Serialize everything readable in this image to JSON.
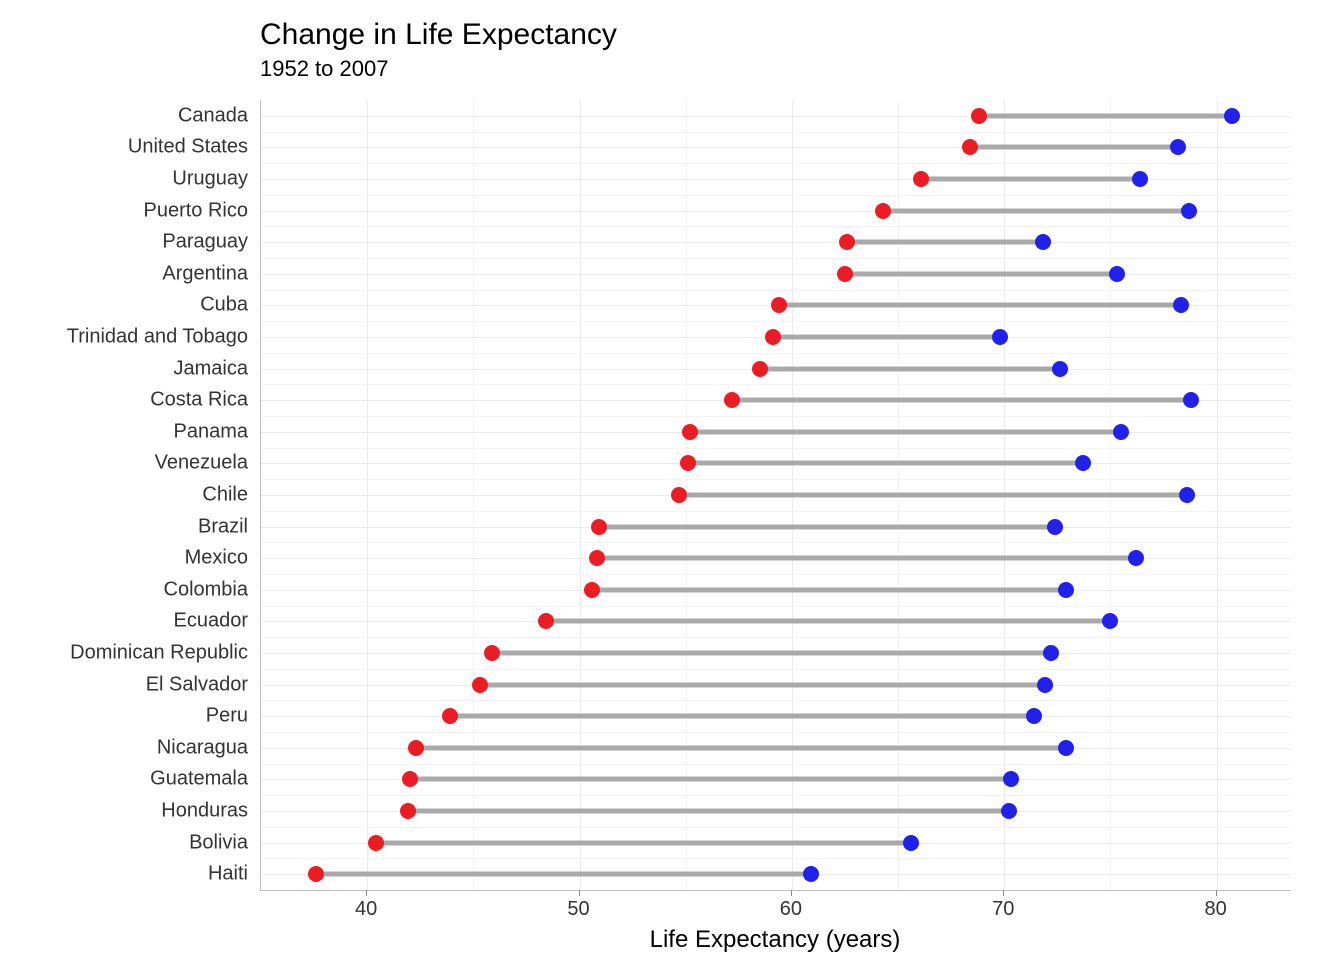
{
  "chart_data": {
    "type": "dumbbell",
    "title": "Change in Life Expectancy",
    "subtitle": "1952 to 2007",
    "xlabel": "Life Expectancy (years)",
    "ylabel": "",
    "xlim": [
      35,
      83.5
    ],
    "x_ticks": [
      40,
      50,
      60,
      70,
      80
    ],
    "colors": {
      "1952": "#ec1c24",
      "2007": "#2121ee",
      "segment": "#a9a9a9"
    },
    "series_names": [
      "1952",
      "2007"
    ],
    "categories": [
      "Canada",
      "United States",
      "Uruguay",
      "Puerto Rico",
      "Paraguay",
      "Argentina",
      "Cuba",
      "Trinidad and Tobago",
      "Jamaica",
      "Costa Rica",
      "Panama",
      "Venezuela",
      "Chile",
      "Brazil",
      "Mexico",
      "Colombia",
      "Ecuador",
      "Dominican Republic",
      "El Salvador",
      "Peru",
      "Nicaragua",
      "Guatemala",
      "Honduras",
      "Bolivia",
      "Haiti"
    ],
    "series": [
      {
        "name": "1952",
        "values": [
          68.8,
          68.4,
          66.1,
          64.3,
          62.6,
          62.5,
          59.4,
          59.1,
          58.5,
          57.2,
          55.2,
          55.1,
          54.7,
          50.9,
          50.8,
          50.6,
          48.4,
          45.9,
          45.3,
          43.9,
          42.3,
          42.0,
          41.9,
          40.4,
          37.6
        ]
      },
      {
        "name": "2007",
        "values": [
          80.7,
          78.2,
          76.4,
          78.7,
          71.8,
          75.3,
          78.3,
          69.8,
          72.6,
          78.8,
          75.5,
          73.7,
          78.6,
          72.4,
          76.2,
          72.9,
          75.0,
          72.2,
          71.9,
          71.4,
          72.9,
          70.3,
          70.2,
          65.6,
          60.9
        ]
      }
    ]
  }
}
